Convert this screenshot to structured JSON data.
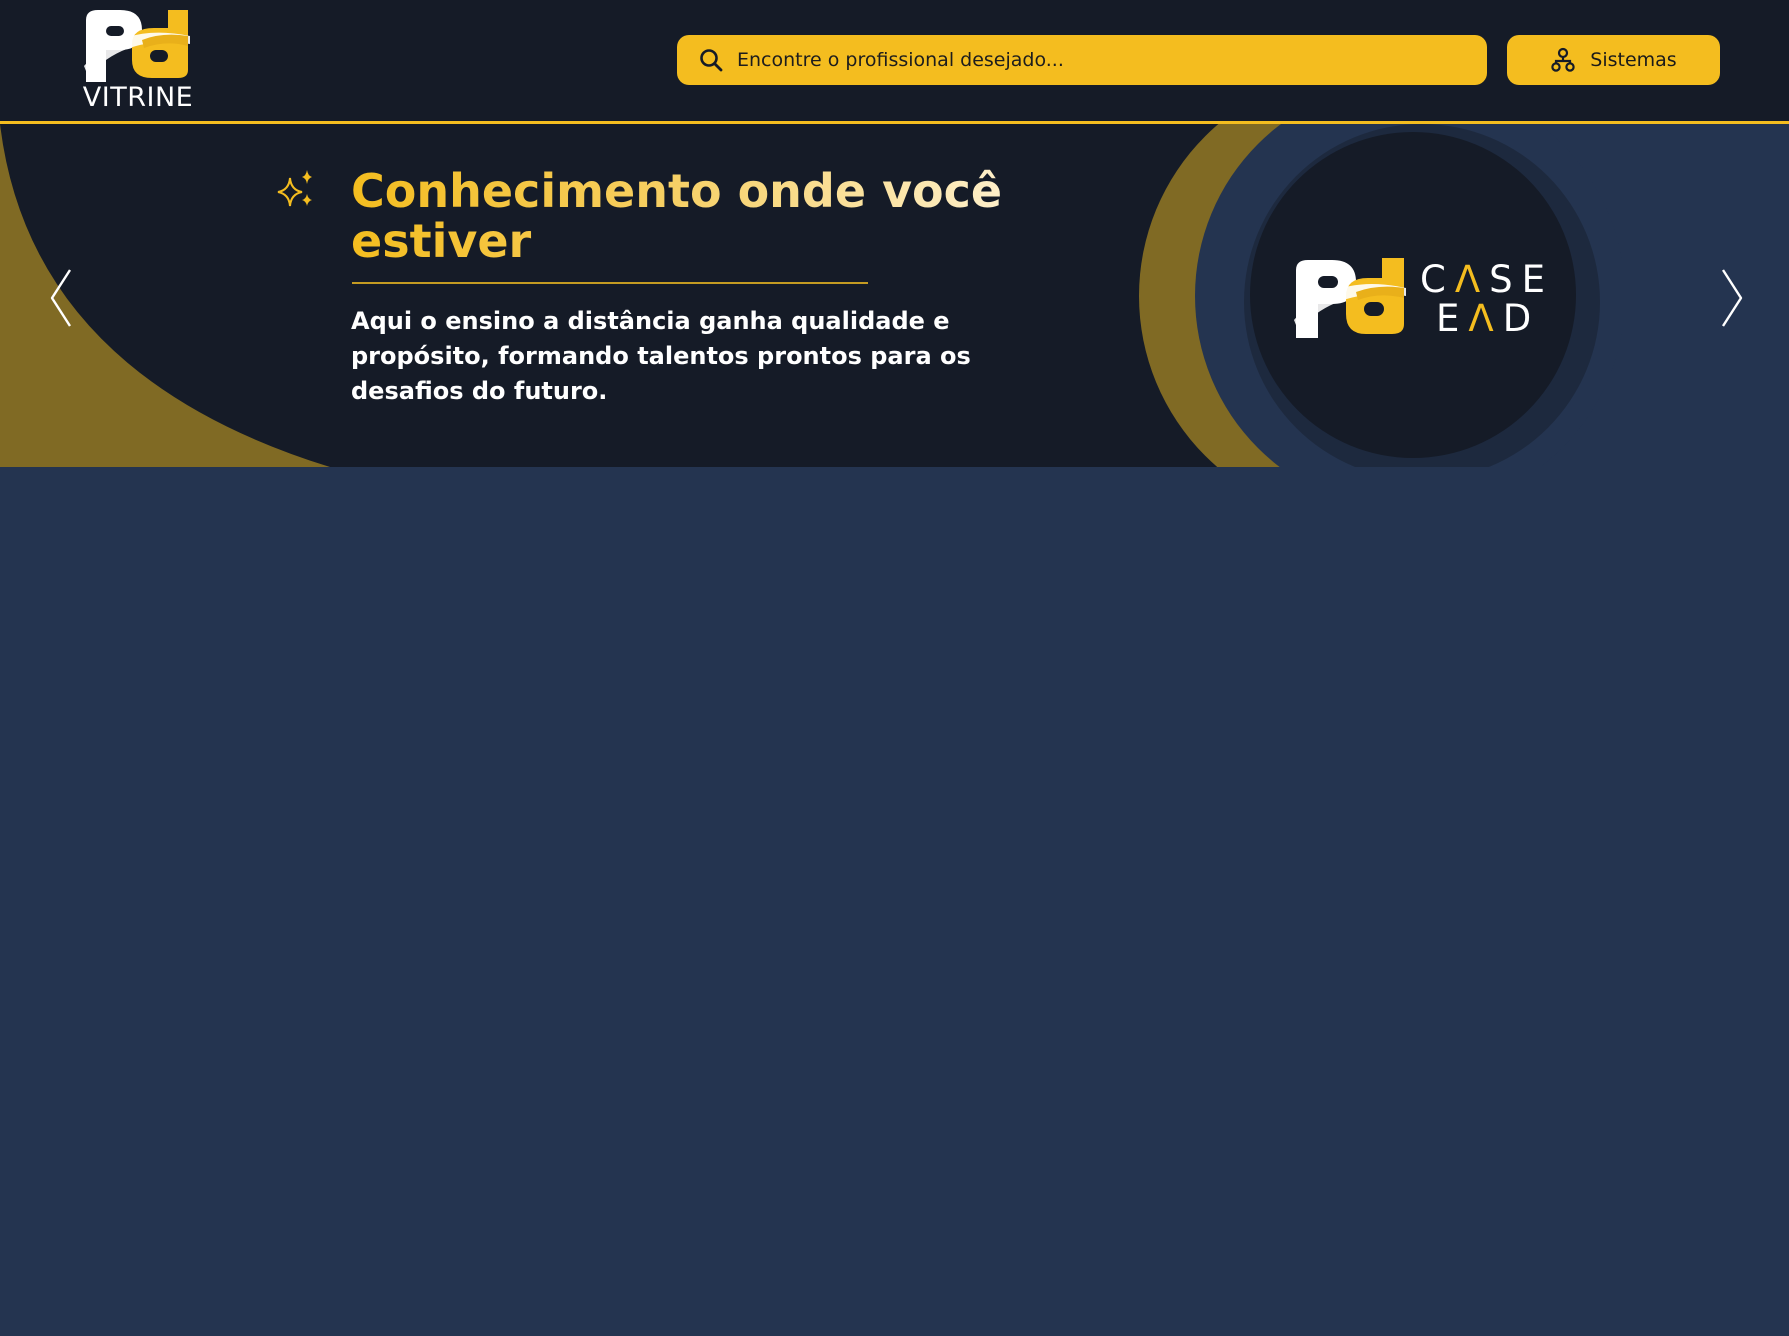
{
  "header": {
    "logo_text": "VITRINE",
    "search": {
      "placeholder": "Encontre o profissional desejado..."
    },
    "systems_button_label": "Sistemas"
  },
  "hero": {
    "title": "Conhecimento onde você estiver",
    "subtitle": "Aqui o ensino a distância ganha qualidade e propósito, formando talentos prontos para os desafios do futuro.",
    "brand": {
      "line1": {
        "before": "C",
        "accent": "Λ",
        "after": "SE"
      },
      "line2": {
        "before": "E",
        "accent": "Λ",
        "after": "D"
      }
    }
  },
  "icons": {
    "search": "search-icon",
    "systems": "sitemap-icon",
    "sparkles": "sparkles-icon",
    "prev": "chevron-left-icon",
    "next": "chevron-right-icon"
  },
  "colors": {
    "header_bg": "#151b27",
    "page_bg": "#243450",
    "accent_yellow": "#f4bd1f",
    "olive_gold": "#806a24",
    "hero_bg": "#151b27",
    "white": "#ffffff"
  }
}
